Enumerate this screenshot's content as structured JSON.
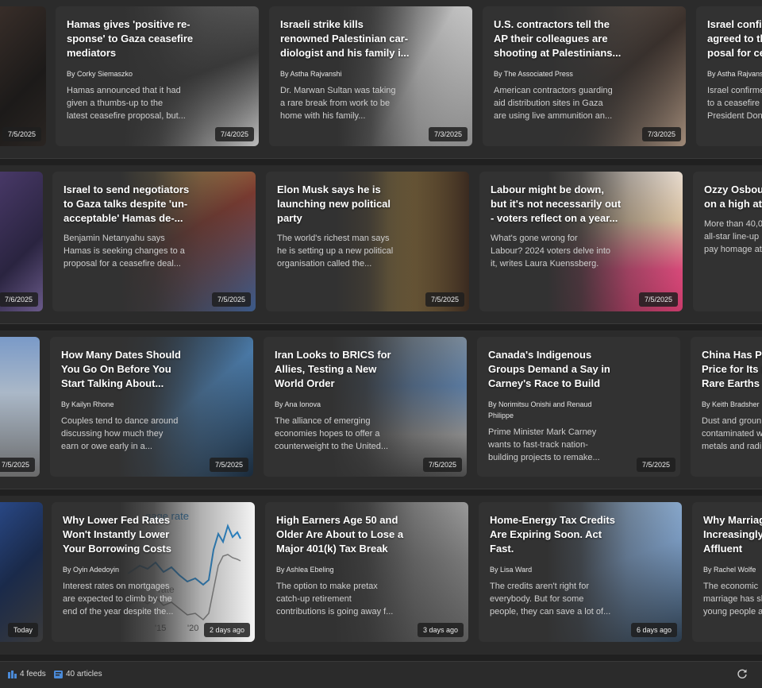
{
  "rows": [
    {
      "cards": [
        {
          "date": "7/5/2025"
        },
        {
          "title": "Hamas gives 'positive re-\nsponse' to Gaza ceasefire\nmediators",
          "author": "By Corky Siemaszko",
          "desc": "Hamas announced that it had\ngiven a thumbs-up to the\nlatest ceasefire proposal, but...",
          "date": "7/4/2025"
        },
        {
          "title": "Israeli strike kills\nrenowned Palestinian car-\ndiologist and his family i...",
          "author": "By Astha Rajvanshi",
          "desc": "Dr. Marwan Sultan was taking\na rare break from work to be\nhome with his family...",
          "date": "7/3/2025"
        },
        {
          "title": "U.S. contractors tell the\nAP their colleagues are\nshooting at Palestinians...",
          "author": "By The Associated Press",
          "desc": "American contractors guarding\naid distribution sites in Gaza\nare using live ammunition an...",
          "date": "7/3/2025"
        },
        {
          "title": "Israel confir\nagreed to th\nposal for ce",
          "author": "By Astha Rajvans",
          "desc": "Israel confirme\nto a ceasefire\nPresident Don",
          "date": ""
        }
      ]
    },
    {
      "cards": [
        {
          "date": "7/6/2025"
        },
        {
          "title": "Israel to send negotiators\nto Gaza talks despite 'un-\nacceptable' Hamas de-...",
          "author": "",
          "desc": "Benjamin Netanyahu says\nHamas is seeking changes to a\nproposal for a ceasefire deal...",
          "date": "7/5/2025"
        },
        {
          "title": "Elon Musk says he is\nlaunching new political\nparty",
          "author": "",
          "desc": "The world's richest man says\nhe is setting up a new political\norganisation called the...",
          "date": "7/5/2025"
        },
        {
          "title": "Labour might be down,\nbut it's not necessarily out\n- voters reflect on a year...",
          "author": "",
          "desc": "What's gone wrong for\nLabour? 2024 voters delve into\nit, writes Laura Kuenssberg.",
          "date": "7/5/2025"
        },
        {
          "title": "Ozzy Osbour\non a high at",
          "author": "",
          "desc": "More than 40,0\nall-star line-up\npay homage at",
          "date": ""
        }
      ]
    },
    {
      "cards": [
        {
          "date": "7/5/2025"
        },
        {
          "title": "How Many Dates Should\nYou Go On Before You\nStart Talking About...",
          "author": "By Kailyn Rhone",
          "desc": "Couples tend to dance around\ndiscussing how much they\nearn or owe early in a...",
          "date": "7/5/2025"
        },
        {
          "title": "Iran Looks to BRICS for\nAllies, Testing a New\nWorld Order",
          "author": "By Ana Ionova",
          "desc": "The alliance of emerging\neconomies hopes to offer a\ncounterweight to the United...",
          "date": "7/5/2025"
        },
        {
          "title": "Canada's Indigenous\nGroups Demand a Say in\nCarney's Race to Build",
          "author": "By Norimitsu Onishi and Renaud\nPhilippe",
          "desc": "Prime Minister Mark Carney\nwants to fast-track nation-\nbuilding projects to remake...",
          "date": "7/5/2025"
        },
        {
          "title": "China Has Pa\nPrice for Its D\nRare Earths",
          "author": "By Keith Bradsher",
          "desc": "Dust and groun\ncontaminated w\nmetals and radi",
          "date": ""
        }
      ]
    },
    {
      "cards": [
        {
          "date": "Today"
        },
        {
          "title": "Why Lower Fed Rates\nWon't Instantly Lower\nYour Borrowing Costs",
          "author": "By Oyin Adedoyin",
          "desc": "Interest rates on mortgages\nare expected to climb by the\nend of the year despite the...",
          "date": "2 days ago",
          "chart_label_1": "gage rate",
          "chart_label_2": "rate",
          "chart_tick_1": "'15",
          "chart_tick_2": "'20"
        },
        {
          "title": "High Earners Age 50 and\nOlder Are About to Lose a\nMajor 401(k) Tax Break",
          "author": "By Ashlea Ebeling",
          "desc": "The option to make pretax\ncatch-up retirement\ncontributions is going away f...",
          "date": "3 days ago"
        },
        {
          "title": "Home-Energy Tax Credits\nAre Expiring Soon. Act\nFast.",
          "author": "By Lisa Ward",
          "desc": "The credits aren't right for\neverybody. But for some\npeople, they can save a lot of...",
          "date": "6 days ago"
        },
        {
          "title": "Why Marriag\nIncreasingly\nAffluent",
          "author": "By Rachel Wolfe",
          "desc": "The economic\nmarriage has sl\nyoung people a",
          "date": ""
        }
      ]
    }
  ],
  "status": {
    "feeds": "4 feeds",
    "articles": "40 articles"
  }
}
